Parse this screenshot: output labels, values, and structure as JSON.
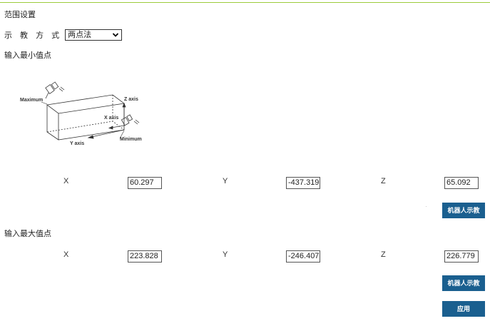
{
  "page": {
    "section_title": "范围设置"
  },
  "method": {
    "label": "示 教 方 式",
    "selected": "两点法"
  },
  "min_point": {
    "heading": "输入最小值点",
    "x_label": "X",
    "x_value": "60.297",
    "y_label": "Y",
    "y_value": "-437.319",
    "z_label": "Z",
    "z_value": "65.092",
    "teach_button": "机器人示教"
  },
  "max_point": {
    "heading": "输入最大值点",
    "x_label": "X",
    "x_value": "223.828",
    "y_label": "Y",
    "y_value": "-246.407",
    "z_label": "Z",
    "z_value": "226.779",
    "teach_button": "机器人示教"
  },
  "diagram": {
    "maximum_label": "Maximum",
    "minimum_label": "Minimum",
    "x_axis_label": "X axis",
    "y_axis_label": "Y axis",
    "z_axis_label": "Z axis"
  },
  "apply_button": "应用",
  "colors": {
    "accent_rule": "#9ccc3c",
    "button_bg": "#1a5f8f"
  }
}
